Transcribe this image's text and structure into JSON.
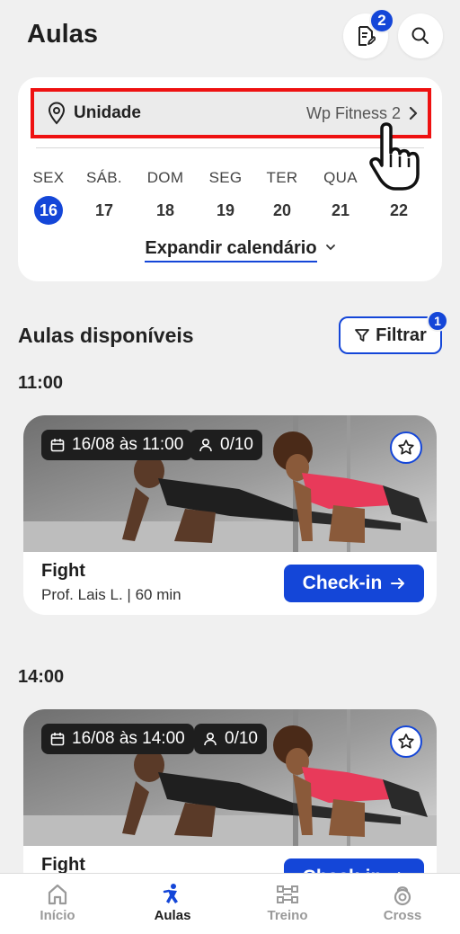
{
  "header": {
    "title": "Aulas",
    "docs_badge": "2"
  },
  "unit": {
    "label": "Unidade",
    "value": "Wp Fitness 2"
  },
  "calendar": {
    "days": [
      {
        "name": "SEX",
        "num": "16",
        "active": true
      },
      {
        "name": "SÁB.",
        "num": "17",
        "active": false
      },
      {
        "name": "DOM",
        "num": "18",
        "active": false
      },
      {
        "name": "SEG",
        "num": "19",
        "active": false
      },
      {
        "name": "TER",
        "num": "20",
        "active": false
      },
      {
        "name": "QUA",
        "num": "21",
        "active": false
      },
      {
        "name": "",
        "num": "22",
        "active": false
      }
    ],
    "expand_label": "Expandir calendário"
  },
  "section": {
    "title": "Aulas disponíveis",
    "filter_label": "Filtrar",
    "filter_badge": "1"
  },
  "classes": [
    {
      "time": "11:00",
      "date_chip": "16/08 às 11:00",
      "capacity_chip": "0/10",
      "name": "Fight",
      "info": "Prof. Lais L. | 60 min",
      "checkin_label": "Check-in"
    },
    {
      "time": "14:00",
      "date_chip": "16/08 às 14:00",
      "capacity_chip": "0/10",
      "name": "Fight",
      "info": "",
      "checkin_label": "Check-in"
    }
  ],
  "nav": {
    "items": [
      {
        "label": "Início",
        "icon": "home-icon",
        "active": false
      },
      {
        "label": "Aulas",
        "icon": "class-icon",
        "active": true
      },
      {
        "label": "Treino",
        "icon": "dumbbell-icon",
        "active": false
      },
      {
        "label": "Cross",
        "icon": "kettlebell-icon",
        "active": false
      }
    ]
  },
  "colors": {
    "accent": "#1446d8",
    "highlight_border": "#ee1111",
    "background": "#f0f0f0"
  }
}
